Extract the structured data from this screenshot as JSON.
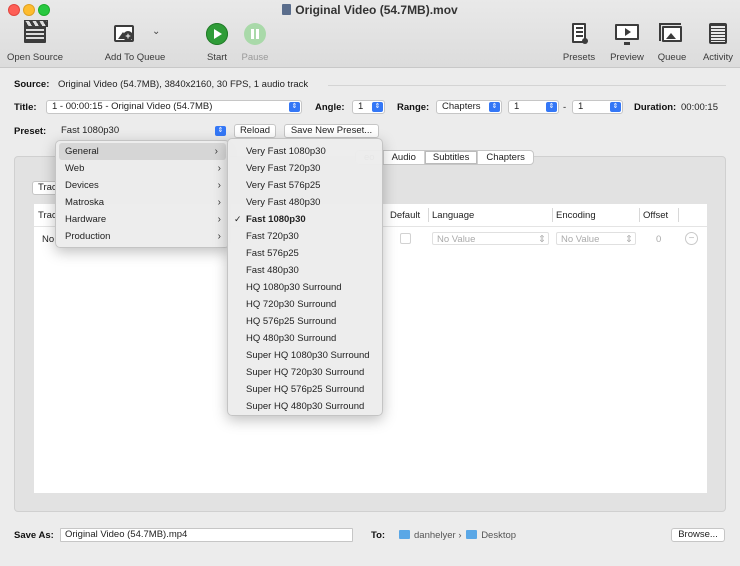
{
  "window": {
    "title": "Original Video (54.7MB).mov"
  },
  "toolbar": {
    "open_source": "Open Source",
    "add_to_queue": "Add To Queue",
    "start": "Start",
    "pause": "Pause",
    "presets": "Presets",
    "preview": "Preview",
    "queue": "Queue",
    "activity": "Activity"
  },
  "source": {
    "label": "Source:",
    "value": "Original Video (54.7MB), 3840x2160, 30 FPS, 1 audio track"
  },
  "title_row": {
    "title_label": "Title:",
    "title_value": "1 - 00:00:15 - Original Video (54.7MB)",
    "angle_label": "Angle:",
    "angle_value": "1",
    "range_label": "Range:",
    "range_mode": "Chapters",
    "range_start": "1",
    "range_sep": "-",
    "range_end": "1",
    "duration_label": "Duration:",
    "duration_value": "00:00:15"
  },
  "preset_row": {
    "label": "Preset:",
    "value": "Fast 1080p30",
    "reload": "Reload",
    "save_new": "Save New Preset..."
  },
  "tabs": [
    {
      "label": "eo"
    },
    {
      "label": "Audio"
    },
    {
      "label": "Subtitles",
      "selected": true
    },
    {
      "label": "Chapters"
    }
  ],
  "subtitles": {
    "tracks_button": "Trac",
    "col_track": "Trac",
    "col_default": "Default",
    "col_language": "Language",
    "col_encoding": "Encoding",
    "col_offset": "Offset",
    "row_track": "No",
    "row_language": "No Value",
    "row_encoding": "No Value",
    "row_offset": "0"
  },
  "preset_menu": {
    "categories": [
      "General",
      "Web",
      "Devices",
      "Matroska",
      "Hardware",
      "Production"
    ],
    "highlighted": "General",
    "general_presets": [
      "Very Fast 1080p30",
      "Very Fast 720p30",
      "Very Fast 576p25",
      "Very Fast 480p30",
      "Fast 1080p30",
      "Fast 720p30",
      "Fast 576p25",
      "Fast 480p30",
      "HQ 1080p30 Surround",
      "HQ 720p30 Surround",
      "HQ 576p25 Surround",
      "HQ 480p30 Surround",
      "Super HQ 1080p30 Surround",
      "Super HQ 720p30 Surround",
      "Super HQ 576p25 Surround",
      "Super HQ 480p30 Surround"
    ],
    "checked": "Fast 1080p30"
  },
  "bottom": {
    "save_as_label": "Save As:",
    "save_as_value": "Original Video (54.7MB).mp4",
    "to_label": "To:",
    "path_user": "danhelyer",
    "path_sep": "›",
    "path_folder": "Desktop",
    "browse": "Browse..."
  },
  "colors": {
    "accent": "#3477f6",
    "start_green": "#2f9c38",
    "folder_blue": "#5aa7e6"
  }
}
